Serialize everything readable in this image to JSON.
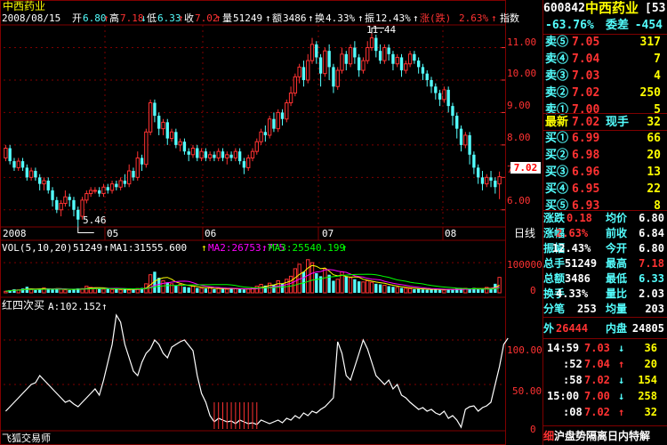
{
  "header": {
    "name": "中西药业",
    "date": "2008/08/15",
    "open_label": "开",
    "open": "6.80",
    "high_label": "高",
    "high": "7.18",
    "low_label": "低",
    "low": "6.33",
    "close_label": "收",
    "close": "7.02",
    "vol_label": "量",
    "vol": "51249",
    "amount_label": "额",
    "amount": "3486",
    "turnover_label": "换",
    "turnover": "4.33%",
    "amplitude_label": "振",
    "amplitude": "12.43%",
    "change_label": "涨(跌)",
    "change": "2.63%",
    "index_label": "指数"
  },
  "colors": {
    "up": "#ff3232",
    "down": "#54ffff",
    "white": "#ffffff",
    "yellow": "#ffff00",
    "magenta": "#ff00ff",
    "green": "#00ff00",
    "grid": "#800000"
  },
  "chart_data": {
    "type": "candlestick",
    "y_axis": {
      "ticks": [
        "11.00",
        "10.00",
        "9.00",
        "8.00",
        "7.00",
        "6.00"
      ],
      "ylim": [
        5.5,
        11.7
      ]
    },
    "x_axis": {
      "ticks": [
        "2008",
        "05",
        "06",
        "07",
        "08"
      ],
      "period_label": "日线"
    },
    "max_label": "11.44",
    "min_label": "5.46",
    "last_price_tag": "7.02",
    "candles": [
      [
        7.6,
        7.9,
        7.5,
        8.0
      ],
      [
        7.9,
        7.5,
        7.4,
        8.0
      ],
      [
        7.5,
        7.3,
        7.2,
        7.6
      ],
      [
        7.3,
        7.5,
        7.2,
        7.6
      ],
      [
        7.5,
        7.3,
        7.2,
        7.6
      ],
      [
        7.3,
        7.0,
        6.9,
        7.4
      ],
      [
        7.0,
        7.2,
        6.9,
        7.3
      ],
      [
        7.2,
        7.0,
        6.9,
        7.3
      ],
      [
        7.0,
        6.8,
        6.6,
        7.1
      ],
      [
        6.8,
        6.9,
        6.6,
        7.0
      ],
      [
        6.9,
        6.6,
        6.5,
        7.0
      ],
      [
        6.6,
        6.3,
        6.1,
        6.7
      ],
      [
        6.3,
        6.0,
        5.9,
        6.4
      ],
      [
        6.0,
        6.2,
        5.8,
        6.3
      ],
      [
        6.2,
        6.4,
        6.1,
        6.6
      ],
      [
        6.4,
        6.3,
        6.1,
        6.5
      ],
      [
        6.3,
        6.0,
        5.8,
        6.4
      ],
      [
        6.0,
        5.7,
        5.46,
        6.1
      ],
      [
        5.8,
        6.3,
        5.7,
        6.4
      ],
      [
        6.3,
        6.5,
        6.2,
        6.6
      ],
      [
        6.5,
        6.6,
        6.4,
        6.7
      ],
      [
        6.6,
        6.6,
        6.5,
        6.7
      ],
      [
        6.6,
        6.5,
        6.4,
        6.7
      ],
      [
        6.5,
        6.7,
        6.4,
        6.8
      ],
      [
        6.7,
        6.6,
        6.5,
        6.8
      ],
      [
        6.6,
        6.8,
        6.5,
        6.9
      ],
      [
        6.8,
        6.7,
        6.6,
        6.9
      ],
      [
        6.7,
        6.9,
        6.6,
        7.0
      ],
      [
        6.9,
        6.8,
        6.7,
        7.1
      ],
      [
        6.8,
        7.2,
        6.7,
        7.4
      ],
      [
        7.2,
        7.0,
        6.9,
        7.3
      ],
      [
        7.0,
        7.6,
        6.9,
        7.8
      ],
      [
        7.6,
        7.4,
        7.2,
        7.7
      ],
      [
        7.4,
        8.4,
        7.3,
        8.5
      ],
      [
        8.4,
        9.3,
        8.3,
        9.4
      ],
      [
        9.3,
        8.9,
        8.7,
        9.4
      ],
      [
        8.9,
        8.5,
        8.3,
        9.0
      ],
      [
        8.5,
        8.7,
        8.3,
        8.8
      ],
      [
        8.7,
        8.2,
        8.0,
        8.8
      ],
      [
        8.2,
        8.4,
        8.1,
        8.5
      ],
      [
        8.4,
        8.0,
        7.9,
        8.5
      ],
      [
        8.0,
        8.1,
        7.8,
        8.2
      ],
      [
        8.1,
        7.8,
        7.7,
        8.2
      ],
      [
        7.8,
        7.7,
        7.5,
        7.9
      ],
      [
        7.7,
        7.9,
        7.6,
        8.0
      ],
      [
        7.9,
        7.6,
        7.5,
        8.0
      ],
      [
        7.6,
        7.8,
        7.5,
        7.9
      ],
      [
        7.8,
        7.6,
        7.5,
        7.9
      ],
      [
        7.6,
        7.7,
        7.5,
        7.8
      ],
      [
        7.7,
        7.6,
        7.5,
        7.8
      ],
      [
        7.6,
        7.8,
        7.5,
        7.9
      ],
      [
        7.8,
        7.6,
        7.5,
        7.9
      ],
      [
        7.6,
        7.7,
        7.4,
        7.8
      ],
      [
        7.7,
        7.6,
        7.5,
        7.8
      ],
      [
        7.6,
        7.8,
        7.5,
        7.9
      ],
      [
        7.8,
        7.5,
        7.4,
        7.9
      ],
      [
        7.5,
        7.3,
        7.1,
        7.6
      ],
      [
        7.3,
        7.6,
        7.2,
        7.7
      ],
      [
        7.6,
        7.8,
        7.5,
        7.9
      ],
      [
        7.8,
        8.1,
        7.7,
        8.2
      ],
      [
        8.1,
        8.4,
        8.0,
        8.5
      ],
      [
        8.4,
        8.3,
        8.1,
        8.6
      ],
      [
        8.3,
        8.8,
        8.2,
        8.9
      ],
      [
        8.8,
        8.5,
        8.4,
        9.0
      ],
      [
        8.5,
        9.0,
        8.4,
        9.1
      ],
      [
        9.0,
        8.8,
        8.6,
        9.1
      ],
      [
        8.8,
        9.3,
        8.7,
        9.4
      ],
      [
        9.3,
        9.6,
        9.2,
        9.8
      ],
      [
        9.6,
        10.1,
        9.5,
        10.2
      ],
      [
        10.1,
        10.4,
        9.9,
        10.5
      ],
      [
        10.4,
        10.0,
        9.8,
        10.6
      ],
      [
        10.0,
        10.6,
        9.9,
        10.8
      ],
      [
        10.6,
        11.1,
        10.5,
        11.3
      ],
      [
        11.1,
        10.7,
        10.5,
        11.2
      ],
      [
        10.7,
        10.2,
        9.8,
        10.8
      ],
      [
        10.2,
        10.9,
        10.1,
        11.0
      ],
      [
        10.9,
        10.4,
        10.0,
        11.1
      ],
      [
        10.4,
        9.8,
        9.6,
        10.5
      ],
      [
        9.8,
        10.3,
        9.7,
        10.4
      ],
      [
        10.3,
        10.8,
        10.2,
        11.0
      ],
      [
        10.8,
        10.5,
        10.3,
        10.9
      ],
      [
        10.5,
        11.0,
        10.4,
        11.1
      ],
      [
        11.0,
        10.7,
        10.5,
        11.2
      ],
      [
        10.7,
        10.3,
        10.1,
        10.8
      ],
      [
        10.3,
        10.6,
        10.2,
        10.7
      ],
      [
        10.6,
        11.0,
        10.5,
        11.2
      ],
      [
        11.0,
        11.3,
        10.9,
        11.44
      ],
      [
        11.3,
        10.9,
        10.7,
        11.4
      ],
      [
        10.9,
        10.6,
        10.5,
        11.1
      ],
      [
        10.6,
        11.0,
        10.5,
        11.1
      ],
      [
        11.0,
        10.8,
        10.6,
        11.1
      ],
      [
        10.8,
        10.5,
        10.3,
        10.9
      ],
      [
        10.5,
        10.7,
        10.4,
        10.8
      ],
      [
        10.7,
        10.3,
        10.1,
        10.8
      ],
      [
        10.3,
        10.5,
        10.2,
        10.6
      ],
      [
        10.5,
        10.8,
        10.4,
        10.9
      ],
      [
        10.8,
        10.6,
        10.5,
        10.9
      ],
      [
        10.6,
        10.4,
        10.2,
        10.7
      ],
      [
        10.4,
        10.2,
        10.0,
        10.5
      ],
      [
        10.2,
        10.0,
        9.8,
        10.3
      ],
      [
        10.0,
        9.8,
        9.6,
        10.1
      ],
      [
        9.8,
        9.6,
        9.4,
        9.9
      ],
      [
        9.6,
        9.4,
        9.2,
        9.7
      ],
      [
        9.4,
        9.7,
        9.3,
        9.8
      ],
      [
        9.7,
        9.2,
        9.0,
        9.8
      ],
      [
        9.2,
        8.9,
        8.6,
        9.3
      ],
      [
        8.9,
        8.5,
        8.2,
        9.0
      ],
      [
        8.5,
        8.0,
        7.8,
        8.6
      ],
      [
        8.0,
        8.3,
        7.9,
        8.4
      ],
      [
        8.3,
        7.7,
        7.4,
        8.4
      ],
      [
        7.7,
        7.3,
        7.1,
        7.8
      ],
      [
        7.3,
        7.0,
        6.8,
        7.4
      ],
      [
        7.0,
        6.8,
        6.6,
        7.2
      ],
      [
        6.8,
        7.0,
        6.7,
        7.1
      ],
      [
        7.0,
        6.9,
        6.7,
        7.2
      ],
      [
        6.9,
        6.7,
        6.5,
        7.0
      ],
      [
        6.8,
        7.02,
        6.33,
        7.18
      ]
    ],
    "volume": {
      "label": "VOL(5,10,20)",
      "value": "51249",
      "ma1_label": "MA1:31555.600",
      "ma2_label": "MA2:26753.775",
      "ma3_label": "MA3:25540.199",
      "ticks": [
        "100000",
        "0"
      ],
      "ymax": 130000,
      "bars": [
        5000,
        9000,
        12000,
        10000,
        14000,
        20000,
        11000,
        9000,
        13000,
        16000,
        15000,
        11000,
        14000,
        12000,
        10000,
        9000,
        12000,
        15000,
        14000,
        22000,
        18000,
        16000,
        14000,
        12000,
        15000,
        11000,
        13000,
        10000,
        12000,
        9000,
        11000,
        14000,
        16000,
        30000,
        60000,
        70000,
        50000,
        40000,
        35000,
        30000,
        25000,
        28000,
        20000,
        18000,
        22000,
        16000,
        15000,
        14000,
        17000,
        12000,
        15000,
        13000,
        12000,
        16000,
        14000,
        12000,
        11000,
        13000,
        15000,
        22000,
        28000,
        24000,
        32000,
        26000,
        40000,
        30000,
        45000,
        55000,
        80000,
        95000,
        70000,
        110000,
        100000,
        65000,
        55000,
        80000,
        60000,
        40000,
        45000,
        70000,
        55000,
        50000,
        45000,
        38000,
        36000,
        40000,
        35000,
        30000,
        28000,
        25000,
        22000,
        20000,
        18000,
        16000,
        15000,
        14000,
        12000,
        13000,
        11000,
        10000,
        11000,
        12000,
        10000,
        9000,
        12000,
        11000,
        14000,
        13000,
        15000,
        12000,
        16000,
        14000,
        12000,
        18000,
        15000,
        30000,
        51249
      ]
    },
    "indicator": {
      "label": "红四次买",
      "value": "A:102.152",
      "ticks": [
        "100.00",
        "50.00",
        "0"
      ],
      "ymax": 130,
      "values": [
        20,
        25,
        30,
        35,
        40,
        45,
        50,
        52,
        60,
        55,
        50,
        45,
        40,
        35,
        30,
        32,
        28,
        25,
        30,
        35,
        40,
        45,
        38,
        55,
        75,
        95,
        128,
        120,
        95,
        80,
        65,
        60,
        75,
        85,
        90,
        100,
        95,
        85,
        80,
        92,
        95,
        98,
        100,
        94,
        88,
        60,
        40,
        30,
        15,
        8,
        12,
        10,
        8,
        9,
        6,
        10,
        8,
        6,
        7,
        5,
        10,
        8,
        6,
        8,
        10,
        7,
        12,
        10,
        15,
        12,
        18,
        15,
        20,
        18,
        22,
        25,
        30,
        35,
        98,
        85,
        60,
        55,
        70,
        85,
        100,
        90,
        75,
        60,
        55,
        50,
        55,
        45,
        50,
        38,
        35,
        30,
        26,
        22,
        24,
        20,
        22,
        18,
        16,
        20,
        12,
        15,
        10,
        2,
        22,
        25,
        26,
        20,
        24,
        26,
        30,
        50,
        70,
        95,
        102
      ]
    }
  },
  "quote": {
    "code": "600842",
    "name": "中西药业",
    "code_suffix": "[53",
    "weibi_value": "-63.76%",
    "weicha_label": "委差",
    "weicha_value": "-454",
    "asks": [
      {
        "label": "卖⑤",
        "price": "7.05",
        "vol": "317"
      },
      {
        "label": "卖④",
        "price": "7.04",
        "vol": "7"
      },
      {
        "label": "卖③",
        "price": "7.03",
        "vol": "4"
      },
      {
        "label": "卖②",
        "price": "7.02",
        "vol": "250"
      },
      {
        "label": "卖①",
        "price": "7.00",
        "vol": "5"
      }
    ],
    "last": {
      "label": "最新",
      "price": "7.02",
      "hand_label": "现手",
      "hand": "32"
    },
    "bids": [
      {
        "label": "买①",
        "price": "6.99",
        "vol": "66"
      },
      {
        "label": "买②",
        "price": "6.98",
        "vol": "20"
      },
      {
        "label": "买③",
        "price": "6.96",
        "vol": "13"
      },
      {
        "label": "买④",
        "price": "6.95",
        "vol": "22"
      },
      {
        "label": "买⑤",
        "price": "6.93",
        "vol": "8"
      }
    ],
    "stats": [
      {
        "l1": "涨跌",
        "v1": "0.18",
        "l2": "均价",
        "v2": "6.80"
      },
      {
        "l1": "涨幅",
        "v1": "2.63%",
        "l2": "前收",
        "v2": "6.84"
      },
      {
        "l1": "振幅",
        "v1": "12.43%",
        "l2": "今开",
        "v2": "6.80"
      },
      {
        "l1": "总手",
        "v1": "51249",
        "l2": "最高",
        "v2": "7.18"
      },
      {
        "l1": "总额",
        "v1": "3486",
        "l2": "最低",
        "v2": "6.33"
      },
      {
        "l1": "换手",
        "v1": "4.33%",
        "l2": "量比",
        "v2": "2.03"
      },
      {
        "l1": "分笔",
        "v1": "253",
        "l2": "均量",
        "v2": "203"
      }
    ],
    "outer_label": "外",
    "outer": "26444",
    "inner_label": "内盘",
    "inner": "24805",
    "ticks": [
      {
        "time": "14:59",
        "price": "7.03",
        "dir": "down",
        "vol": "36"
      },
      {
        "time": ":52",
        "price": "7.04",
        "dir": "up",
        "vol": "20"
      },
      {
        "time": ":58",
        "price": "7.02",
        "dir": "down",
        "vol": "154"
      },
      {
        "time": "15:00",
        "price": "7.00",
        "dir": "down",
        "vol": "258"
      },
      {
        "time": ":08",
        "price": "7.02",
        "dir": "up",
        "vol": "32"
      }
    ],
    "footer_tag": "细",
    "footer_text": "沪盘势隔离日内特解"
  },
  "status_bar": {
    "label": "飞狐交易师"
  }
}
